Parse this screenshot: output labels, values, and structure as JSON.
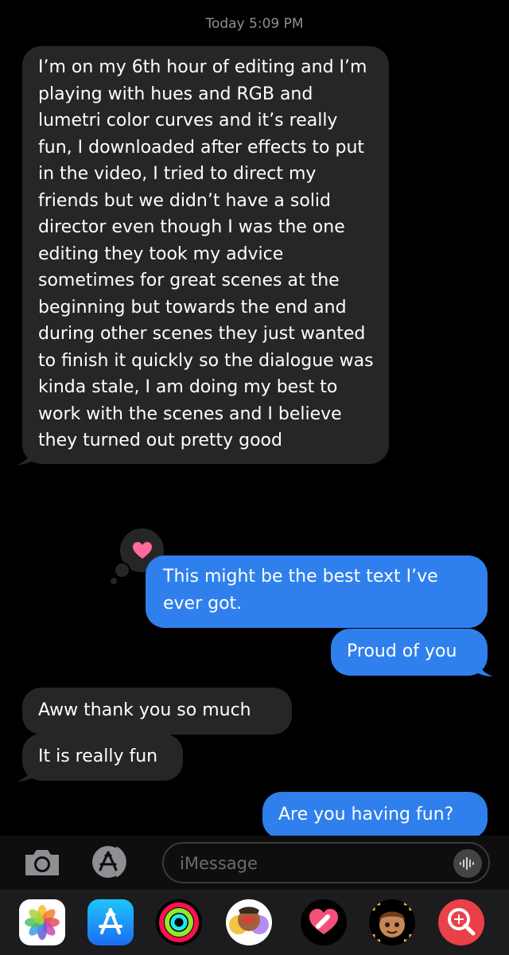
{
  "thread": {
    "timestamp_day": "Today",
    "timestamp_time": "5:09 PM"
  },
  "messages": [
    {
      "id": "msg1",
      "side": "received",
      "text": "I’m on my 6th hour of editing and I’m playing with hues and RGB and lumetri color curves and it’s really fun, I downloaded after effects to put in the video, I tried to direct my friends but we didn’t have a solid director even though I was the one editing they took my advice sometimes for great scenes at the beginning but towards the end and during other scenes they just wanted to finish it quickly so the dialogue was kinda stale, I am doing my best to work with the scenes and I believe they turned out pretty good"
    },
    {
      "id": "msg2",
      "side": "sent",
      "text": "This might be the best text I’ve ever got."
    },
    {
      "id": "msg3",
      "side": "sent",
      "text": "Proud of you"
    },
    {
      "id": "msg4",
      "side": "received",
      "text": "Aww thank you so much"
    },
    {
      "id": "msg5",
      "side": "received",
      "text": "It is really fun"
    },
    {
      "id": "msg6",
      "side": "sent",
      "text": "Are you having fun?"
    }
  ],
  "tapback": {
    "icon": "heart-icon",
    "color": "#ff6b9a"
  },
  "composer": {
    "placeholder": "iMessage",
    "camera_icon": "camera-icon",
    "apps_icon": "app-store-icon",
    "audio_icon": "audio-waveform-icon"
  },
  "app_drawer": [
    {
      "name": "photos-app-icon"
    },
    {
      "name": "app-store-app-icon"
    },
    {
      "name": "activity-app-icon"
    },
    {
      "name": "memoji-stickers-app-icon"
    },
    {
      "name": "digital-touch-app-icon"
    },
    {
      "name": "memoji-app-icon"
    },
    {
      "name": "images-search-app-icon"
    }
  ],
  "colors": {
    "sent_bubble": "#2f80ed",
    "received_bubble": "#262629",
    "background": "#000000"
  }
}
